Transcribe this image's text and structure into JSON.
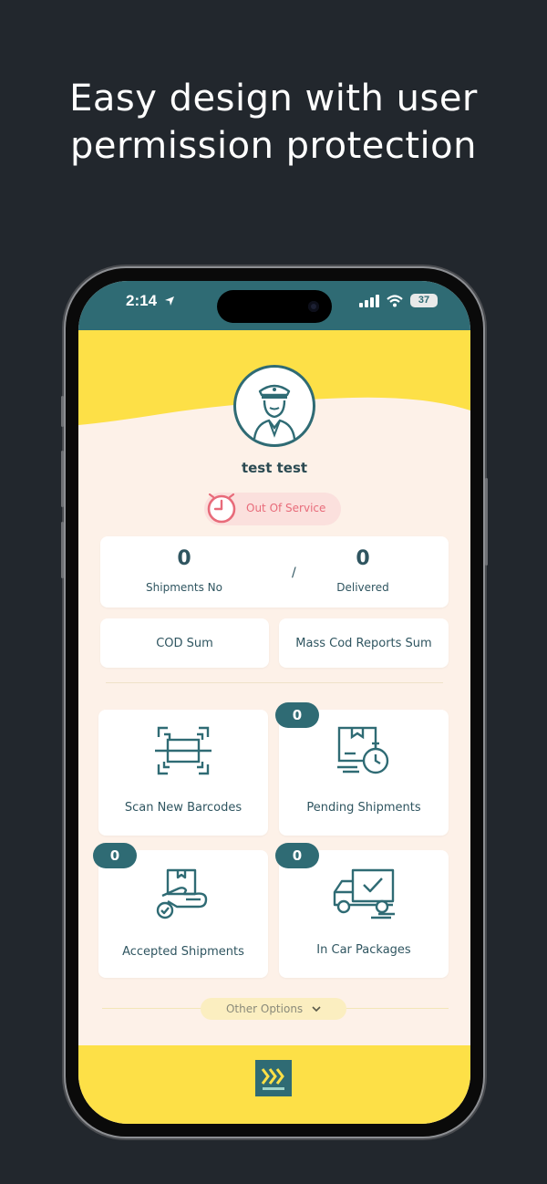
{
  "headline": {
    "line1": "Easy design with user",
    "line2": "permission protection"
  },
  "status_bar": {
    "time": "2:14",
    "battery": "37",
    "icons": [
      "location-arrow-icon",
      "signal-icon",
      "wifi-icon",
      "battery-icon"
    ]
  },
  "profile": {
    "name": "test test",
    "status_label": "Out Of Service",
    "status_icon": "clock-icon"
  },
  "stats": {
    "shipments_no_value": "0",
    "shipments_no_label": "Shipments No",
    "separator": "/",
    "delivered_value": "0",
    "delivered_label": "Delivered"
  },
  "sums": {
    "cod_label": "COD Sum",
    "mass_cod_label": "Mass Cod Reports Sum"
  },
  "tiles": [
    {
      "label": "Scan New Barcodes",
      "badge": null,
      "icon": "barcode-scan-icon"
    },
    {
      "label": "Pending Shipments",
      "badge": "0",
      "icon": "pending-box-timer-icon"
    },
    {
      "label": "Accepted Shipments",
      "badge": "0",
      "icon": "hand-box-check-icon"
    },
    {
      "label": "In Car Packages",
      "badge": "0",
      "icon": "delivery-truck-icon"
    }
  ],
  "other_options": {
    "label": "Other Options",
    "icon": "chevron-down-icon"
  },
  "colors": {
    "background": "#22272d",
    "primary": "#2f6b74",
    "yellow": "#fde047",
    "cream": "#fdf1e8",
    "alert_pink": "#e86b7a"
  }
}
